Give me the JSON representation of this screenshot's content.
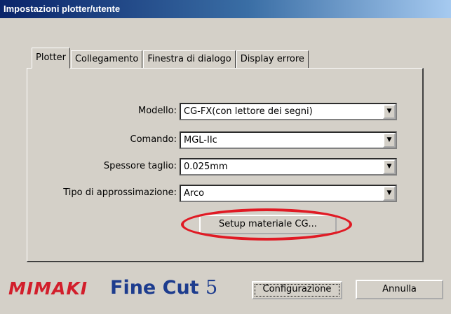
{
  "window": {
    "title": "Impostazioni plotter/utente"
  },
  "tabs": [
    {
      "label": "Plotter",
      "active": true
    },
    {
      "label": "Collegamento",
      "active": false
    },
    {
      "label": "Finestra di dialogo",
      "active": false
    },
    {
      "label": "Display errore",
      "active": false
    }
  ],
  "form": {
    "model": {
      "label": "Modello:",
      "value": "CG-FX(con lettore dei segni)"
    },
    "command": {
      "label": "Comando:",
      "value": "MGL-IIc"
    },
    "cut_thickness": {
      "label": "Spessore taglio:",
      "value": "0.025mm"
    },
    "approximation": {
      "label": "Tipo di approssimazione:",
      "value": "Arco"
    }
  },
  "setup_button": {
    "label": "Setup materiale CG..."
  },
  "footer": {
    "brand": "MIMAKI",
    "product_name": "Fine Cut",
    "product_version": "5",
    "configure_label": "Configurazione",
    "cancel_label": "Annulla"
  },
  "colors": {
    "highlight": "#e01a24",
    "brand_red": "#d21e2b",
    "brand_blue": "#1d3c8e"
  },
  "icons": {
    "dropdown": "chevron-down-icon"
  }
}
